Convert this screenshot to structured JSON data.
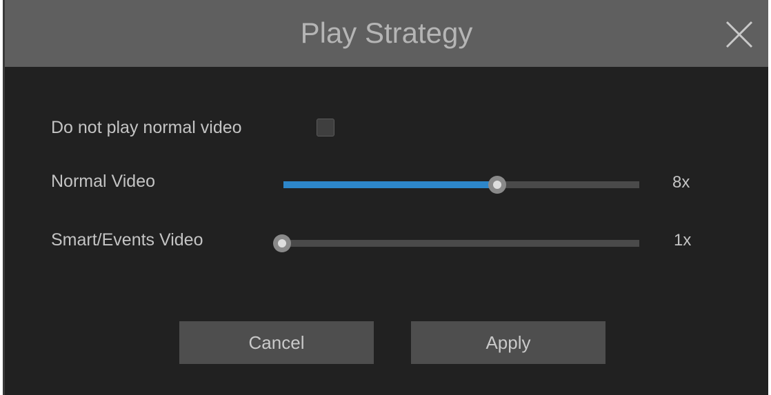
{
  "dialog": {
    "title": "Play Strategy",
    "close_icon": "close-icon"
  },
  "options": {
    "no_normal_label": "Do not play normal video",
    "no_normal_checked": false
  },
  "normal_video": {
    "label": "Normal Video",
    "value_text": "8x",
    "level_fraction": 0.6
  },
  "smart_video": {
    "label": "Smart/Events Video",
    "value_text": "1x",
    "level_fraction": 0.0
  },
  "buttons": {
    "cancel": "Cancel",
    "apply": "Apply"
  },
  "colors": {
    "accent": "#2d86c9",
    "titlebar": "#5f5f5f",
    "background": "#212121"
  }
}
